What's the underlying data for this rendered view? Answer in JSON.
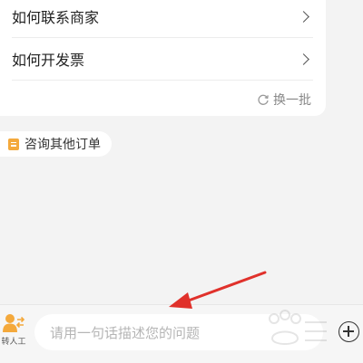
{
  "faq": {
    "items": [
      {
        "label": "如何联系商家"
      },
      {
        "label": "如何开发票"
      }
    ],
    "refresh_label": "换一批"
  },
  "quick_chip": {
    "label": "咨询其他订单"
  },
  "bottom_bar": {
    "transfer_label": "转人工",
    "input_placeholder": "请用一句话描述您的问题"
  },
  "colors": {
    "accent_orange": "#f4a93c",
    "annotation_arrow": "#e0312b"
  }
}
